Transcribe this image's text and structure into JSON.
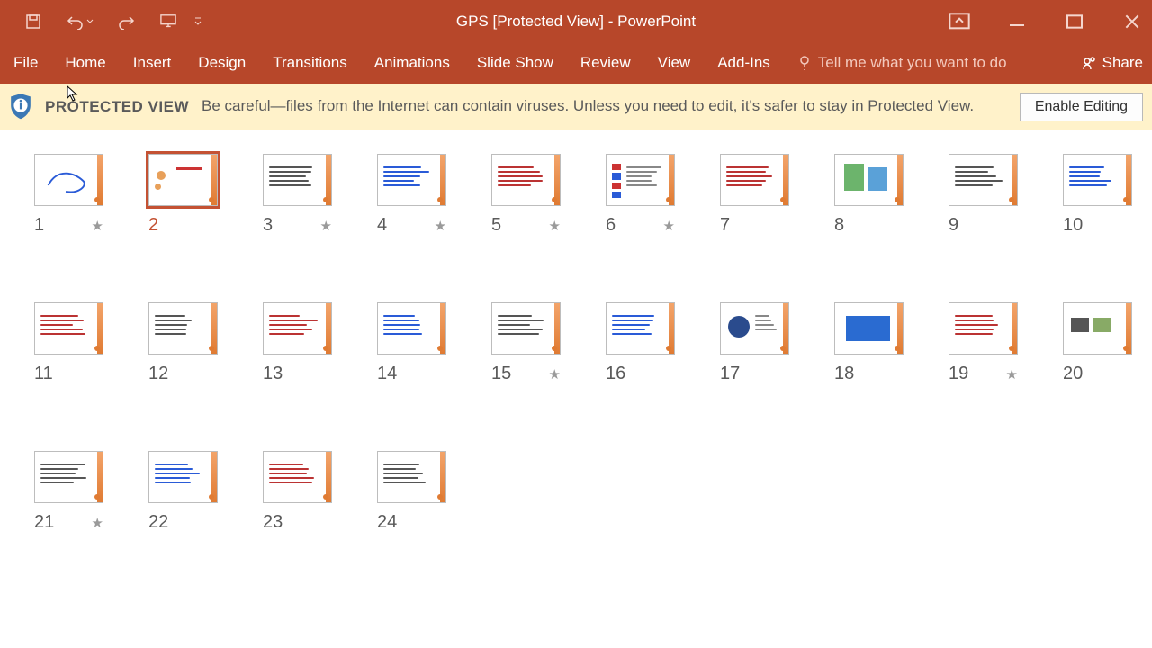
{
  "title": "GPS  [Protected View]  -  PowerPoint",
  "qat": {
    "save": "save-icon",
    "undo": "undo-icon",
    "redo": "redo-icon",
    "startFromBeginning": "present-icon"
  },
  "ribbon": {
    "tabs": [
      "File",
      "Home",
      "Insert",
      "Design",
      "Transitions",
      "Animations",
      "Slide Show",
      "Review",
      "View",
      "Add-Ins"
    ],
    "tellme_placeholder": "Tell me what you want to do",
    "share": "Share"
  },
  "protected_view": {
    "label": "PROTECTED VIEW",
    "message": "Be careful—files from the Internet can contain viruses. Unless you need to edit, it's safer to stay in Protected View.",
    "button": "Enable Editing"
  },
  "slides": [
    {
      "n": 1,
      "star": true,
      "selected": false
    },
    {
      "n": 2,
      "star": false,
      "selected": true
    },
    {
      "n": 3,
      "star": true,
      "selected": false
    },
    {
      "n": 4,
      "star": true,
      "selected": false
    },
    {
      "n": 5,
      "star": true,
      "selected": false
    },
    {
      "n": 6,
      "star": true,
      "selected": false
    },
    {
      "n": 7,
      "star": false,
      "selected": false
    },
    {
      "n": 8,
      "star": false,
      "selected": false
    },
    {
      "n": 9,
      "star": false,
      "selected": false
    },
    {
      "n": 10,
      "star": false,
      "selected": false
    },
    {
      "n": 11,
      "star": false,
      "selected": false
    },
    {
      "n": 12,
      "star": false,
      "selected": false
    },
    {
      "n": 13,
      "star": false,
      "selected": false
    },
    {
      "n": 14,
      "star": false,
      "selected": false
    },
    {
      "n": 15,
      "star": true,
      "selected": false
    },
    {
      "n": 16,
      "star": false,
      "selected": false
    },
    {
      "n": 17,
      "star": false,
      "selected": false
    },
    {
      "n": 18,
      "star": false,
      "selected": false
    },
    {
      "n": 19,
      "star": true,
      "selected": false
    },
    {
      "n": 20,
      "star": false,
      "selected": false
    },
    {
      "n": 21,
      "star": true,
      "selected": false
    },
    {
      "n": 22,
      "star": false,
      "selected": false
    },
    {
      "n": 23,
      "star": false,
      "selected": false
    },
    {
      "n": 24,
      "star": false,
      "selected": false
    }
  ]
}
